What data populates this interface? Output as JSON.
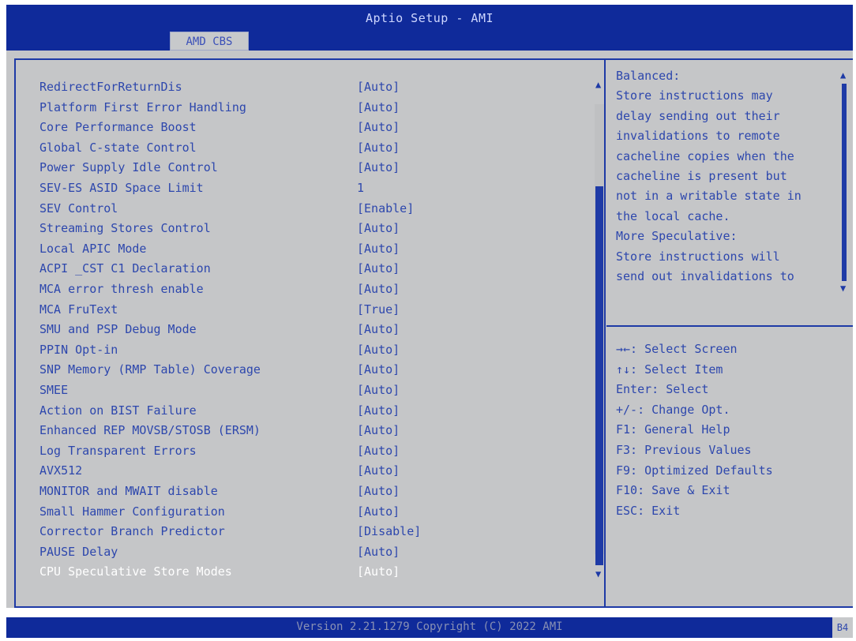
{
  "header": {
    "title": "Aptio Setup - AMI",
    "tab": "AMD CBS"
  },
  "settings": [
    {
      "label": "RedirectForReturnDis",
      "value": "[Auto]"
    },
    {
      "label": "Platform First Error Handling",
      "value": "[Auto]"
    },
    {
      "label": "Core Performance Boost",
      "value": "[Auto]"
    },
    {
      "label": "Global C-state Control",
      "value": "[Auto]"
    },
    {
      "label": "Power Supply Idle Control",
      "value": "[Auto]"
    },
    {
      "label": "SEV-ES ASID Space Limit",
      "value": "1"
    },
    {
      "label": "SEV Control",
      "value": "[Enable]"
    },
    {
      "label": "Streaming Stores Control",
      "value": "[Auto]"
    },
    {
      "label": "Local APIC Mode",
      "value": "[Auto]"
    },
    {
      "label": "ACPI _CST C1 Declaration",
      "value": "[Auto]"
    },
    {
      "label": "MCA error thresh enable",
      "value": "[Auto]"
    },
    {
      "label": "MCA FruText",
      "value": "[True]"
    },
    {
      "label": "SMU and PSP Debug Mode",
      "value": "[Auto]"
    },
    {
      "label": "PPIN Opt-in",
      "value": "[Auto]"
    },
    {
      "label": "SNP Memory (RMP Table) Coverage",
      "value": "[Auto]"
    },
    {
      "label": "SMEE",
      "value": "[Auto]"
    },
    {
      "label": "Action on BIST Failure",
      "value": "[Auto]"
    },
    {
      "label": "Enhanced REP MOVSB/STOSB (ERSM)",
      "value": "[Auto]"
    },
    {
      "label": "Log Transparent Errors",
      "value": "[Auto]"
    },
    {
      "label": "AVX512",
      "value": "[Auto]"
    },
    {
      "label": "MONITOR and MWAIT disable",
      "value": "[Auto]"
    },
    {
      "label": "Small Hammer Configuration",
      "value": "[Auto]"
    },
    {
      "label": "Corrector Branch Predictor",
      "value": "[Disable]"
    },
    {
      "label": "PAUSE Delay",
      "value": "[Auto]"
    },
    {
      "label": "CPU Speculative Store Modes",
      "value": "[Auto]",
      "selected": true
    }
  ],
  "help": {
    "text": "Balanced:\nStore instructions may\ndelay sending out their\ninvalidations to remote\ncacheline copies when the\ncacheline is present but\nnot in a writable state in\nthe local cache.\nMore Speculative:\nStore instructions will\nsend out invalidations to"
  },
  "keys": [
    "→←: Select Screen",
    "↑↓: Select Item",
    "Enter: Select",
    "+/-: Change Opt.",
    "F1: General Help",
    "F3: Previous Values",
    "F9: Optimized Defaults",
    "F10: Save & Exit",
    "ESC: Exit"
  ],
  "footer": {
    "version": "Version 2.21.1279 Copyright (C) 2022 AMI",
    "code": "B4"
  },
  "scroll_arrows": {
    "up": "▲",
    "down": "▼"
  }
}
